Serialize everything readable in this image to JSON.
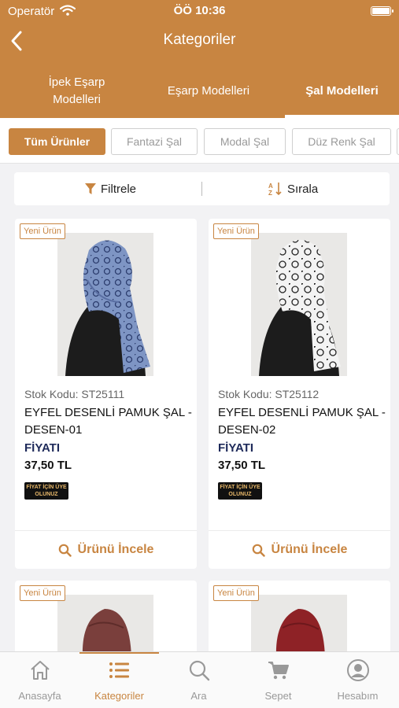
{
  "status": {
    "carrier": "Operatör",
    "time": "ÖÖ 10:36"
  },
  "nav": {
    "title": "Kategoriler"
  },
  "category_tabs": [
    {
      "label": "İpek Eşarp Modelleri"
    },
    {
      "label": "Eşarp Modelleri"
    },
    {
      "label": "Şal Modelleri",
      "active": true
    }
  ],
  "chips": [
    {
      "label": "Tüm Ürünler",
      "active": true
    },
    {
      "label": "Fantazi Şal"
    },
    {
      "label": "Modal Şal"
    },
    {
      "label": "Düz Renk Şal"
    }
  ],
  "toolbar": {
    "filter_label": "Filtrele",
    "sort_label": "Sırala"
  },
  "products": [
    {
      "badge": "Yeni Ürün",
      "stock": "Stok Kodu: ST25111",
      "name": "EYFEL DESENLİ PAMUK ŞAL - DESEN-01",
      "price_label": "FİYATI",
      "price": "37,50 TL",
      "promo": "FİYAT İÇİN ÜYE OLUNUZ",
      "action": "Ürünü İncele",
      "color": "#7e95c4"
    },
    {
      "badge": "Yeni Ürün",
      "stock": "Stok Kodu: ST25112",
      "name": "EYFEL DESENLİ PAMUK ŞAL - DESEN-02",
      "price_label": "FİYATI",
      "price": "37,50 TL",
      "promo": "FİYAT İÇİN ÜYE OLUNUZ",
      "action": "Ürünü İncele",
      "color": "#f3f3f3"
    },
    {
      "badge": "Yeni Ürün",
      "color": "#7a3f3c"
    },
    {
      "badge": "Yeni Ürün",
      "color": "#8e2226"
    }
  ],
  "tabbar": [
    {
      "label": "Anasayfa",
      "icon": "home-icon"
    },
    {
      "label": "Kategoriler",
      "icon": "list-icon",
      "active": true
    },
    {
      "label": "Ara",
      "icon": "search-icon"
    },
    {
      "label": "Sepet",
      "icon": "cart-icon"
    },
    {
      "label": "Hesabım",
      "icon": "user-icon"
    }
  ],
  "colors": {
    "brand": "#c88541",
    "price_label": "#1e2a5a"
  }
}
